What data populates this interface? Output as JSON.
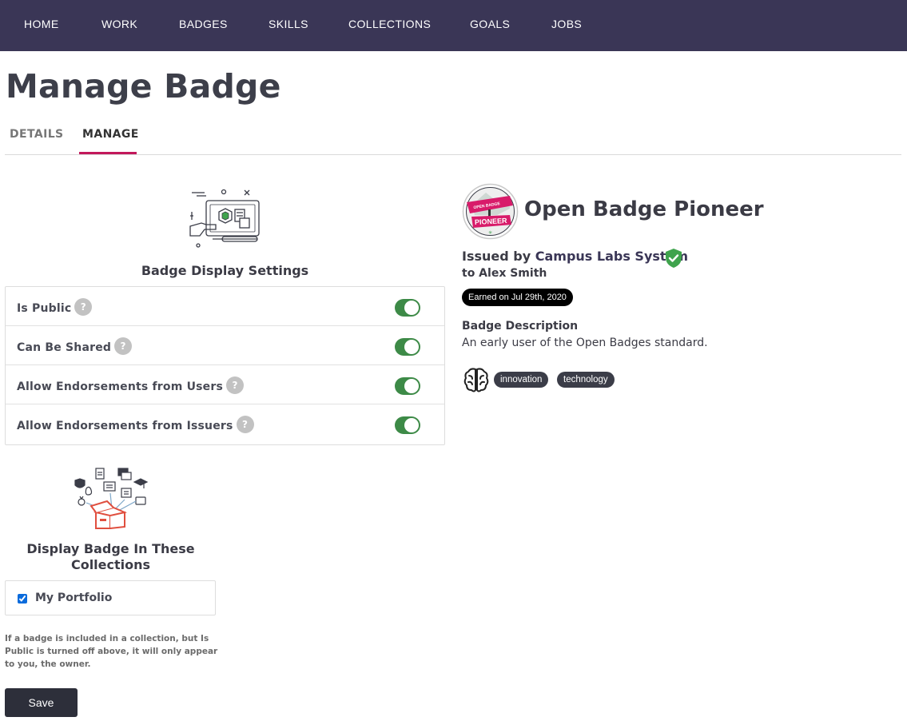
{
  "nav": {
    "items": [
      "HOME",
      "WORK",
      "BADGES",
      "SKILLS",
      "COLLECTIONS",
      "GOALS",
      "JOBS"
    ]
  },
  "page": {
    "title": "Manage Badge"
  },
  "tabs": [
    {
      "label": "DETAILS",
      "active": false
    },
    {
      "label": "MANAGE",
      "active": true
    }
  ],
  "display_settings": {
    "heading": "Badge Display Settings",
    "illustration_icon": "tablet-badge-illustration",
    "help_icon_glyph": "?",
    "items": [
      {
        "label": "Is Public",
        "enabled": true
      },
      {
        "label": "Can Be Shared",
        "enabled": true
      },
      {
        "label": "Allow Endorsements from Users",
        "enabled": true
      },
      {
        "label": "Allow Endorsements from Issuers",
        "enabled": true
      }
    ]
  },
  "collections": {
    "heading": "Display Badge In These Collections",
    "illustration_icon": "collections-box-illustration",
    "items": [
      {
        "label": "My Portfolio",
        "checked": true
      }
    ],
    "note": "If a badge is included in a collection, but Is Public is turned off above, it will only appear to you, the owner."
  },
  "actions": {
    "save_label": "Save"
  },
  "badge": {
    "image_icon": "open-badge-pioneer-badge",
    "image_text_top": "OPEN BADGE",
    "image_text_banner": "PIONEER",
    "name": "Open Badge Pioneer",
    "issued_by_prefix": "Issued by",
    "issuer": "Campus Labs System",
    "verified_icon": "shield-check-icon",
    "recipient": "to Alex Smith",
    "earned": "Earned on Jul 29th, 2020",
    "description_title": "Badge Description",
    "description": "An early user of the Open Badges standard.",
    "tags_icon": "brain-icon",
    "tags": [
      "innovation",
      "technology"
    ]
  },
  "colors": {
    "nav_bg": "#3a3656",
    "accent": "#c2185b",
    "toggle_on": "#3d8a47",
    "verified": "#3fa34d",
    "button_bg": "#2d2f3a"
  }
}
